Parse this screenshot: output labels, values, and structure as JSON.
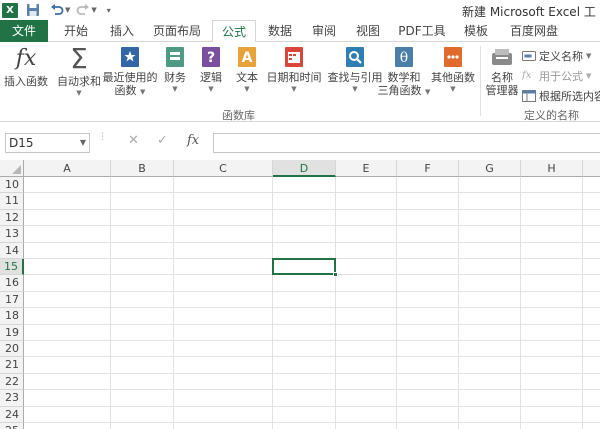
{
  "window": {
    "title": "新建 Microsoft Excel 工"
  },
  "tabs": {
    "file": "文件",
    "items": [
      {
        "label": "开始"
      },
      {
        "label": "插入"
      },
      {
        "label": "页面布局"
      },
      {
        "label": "公式"
      },
      {
        "label": "数据"
      },
      {
        "label": "审阅"
      },
      {
        "label": "视图"
      },
      {
        "label": "PDF工具"
      },
      {
        "label": "模板"
      },
      {
        "label": "百度网盘"
      }
    ],
    "active": "公式"
  },
  "ribbon": {
    "function_library": {
      "group_label": "函数库",
      "insert_function": "插入函数",
      "autosum": "自动求和",
      "recently_used_line1": "最近使用的",
      "recently_used_line2": "函数",
      "financial": "财务",
      "logical": "逻辑",
      "text": "文本",
      "date_time": "日期和时间",
      "lookup_reference": "查找与引用",
      "math_trig_line1": "数学和",
      "math_trig_line2": "三角函数",
      "more_functions": "其他函数"
    },
    "defined_names": {
      "group_label": "定义的名称",
      "name_manager_line1": "名称",
      "name_manager_line2": "管理器",
      "define_name": "定义名称",
      "use_in_formula": "用于公式",
      "create_from_selection": "根据所选内容"
    }
  },
  "formula_bar": {
    "name_box": "D15",
    "fx": "fx",
    "cancel": "✕",
    "enter": "✓",
    "value": ""
  },
  "sheet": {
    "columns": [
      "A",
      "B",
      "C",
      "D",
      "E",
      "F",
      "G",
      "H"
    ],
    "rows": [
      "10",
      "11",
      "12",
      "13",
      "14",
      "15",
      "16",
      "17",
      "18",
      "19",
      "20",
      "21",
      "22",
      "23",
      "24",
      "25"
    ],
    "selected_cell": {
      "column": "D",
      "row": "15"
    },
    "accent_color": "#217346"
  }
}
